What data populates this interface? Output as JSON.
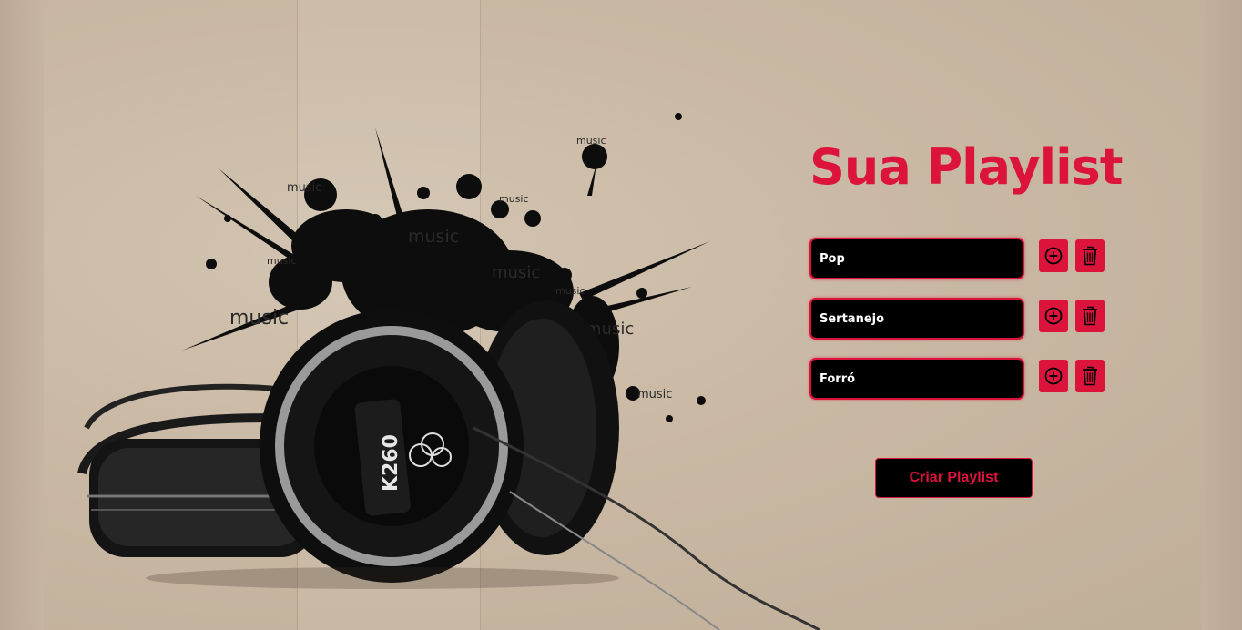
{
  "title": "Sua Playlist",
  "playlist": {
    "items": [
      {
        "value": "Pop",
        "add_icon": "plus-circle-icon",
        "delete_icon": "trash-icon"
      },
      {
        "value": "Sertanejo",
        "add_icon": "plus-circle-icon",
        "delete_icon": "trash-icon"
      },
      {
        "value": "Forró",
        "add_icon": "plus-circle-icon",
        "delete_icon": "trash-icon"
      }
    ]
  },
  "create_button": {
    "label": "Criar Playlist"
  },
  "background": {
    "headphone_model": "K260",
    "splash_word": "music"
  },
  "colors": {
    "accent": "#dc143c",
    "field_bg": "#000000",
    "background": "#c8b8a4"
  }
}
